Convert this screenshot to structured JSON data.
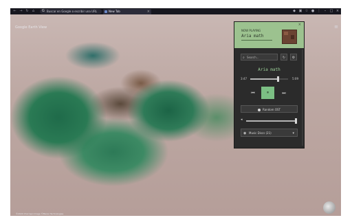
{
  "browser": {
    "address_text": "Buscar en Google o escribir una URL",
    "tab_title": "New Tab"
  },
  "earth": {
    "label": "Google Earth View",
    "credit": "©2024 Chorrapo Image ©Maxar Technologies"
  },
  "popup": {
    "now_playing_label": "NOW PLAYING",
    "now_playing_song": "Aria math",
    "search_placeholder": "Search...",
    "current_song": "Aria math",
    "time_current": "3:47",
    "time_total": "5:09",
    "progress_fraction": 0.73,
    "volume_fraction": 0.98,
    "random_button_label": "Random OST",
    "playlist_label": "Music Discs (21)"
  }
}
